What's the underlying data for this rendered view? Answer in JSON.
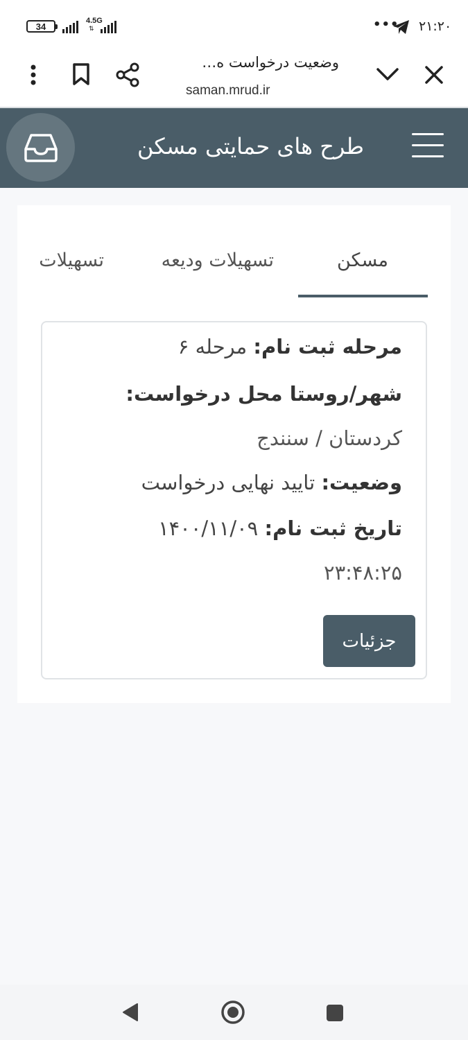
{
  "status_bar": {
    "battery": "34",
    "network_type": "4.5G",
    "time": "۲۱:۲۰",
    "more_dots": "•••"
  },
  "browser": {
    "page_title": "وضعیت درخواست ه…",
    "url": "saman.mrud.ir"
  },
  "header": {
    "title": "طرح های حمایتی مسکن"
  },
  "tabs": [
    {
      "label": "مسکن",
      "active": true
    },
    {
      "label": "تسهیلات ودیعه",
      "active": false
    },
    {
      "label": "تسهیلات",
      "active": false
    }
  ],
  "info": {
    "stage_label": "مرحله ثبت نام:",
    "stage_value": "مرحله ۶",
    "city_label": "شهر/روستا محل درخواست:",
    "city_value": "کردستان / سنندج",
    "status_label": "وضعیت:",
    "status_value": "تایید نهایی درخواست",
    "date_label": "تاریخ ثبت نام:",
    "date_value": "۱۴۰۰/۱۱/۰۹",
    "time_value": "۲۳:۴۸:۲۵",
    "details_button": "جزئیات"
  },
  "colors": {
    "header_bg": "#4a5d68",
    "button_bg": "#4a5d68",
    "page_bg": "#f7f8fa"
  },
  "icons": [
    "battery-icon",
    "signal-icon",
    "telegram-icon",
    "more-icon",
    "close-icon",
    "chevron-down-icon",
    "share-icon",
    "bookmark-icon",
    "kebab-menu-icon",
    "inbox-icon",
    "hamburger-icon",
    "back-icon",
    "home-icon",
    "recents-icon"
  ]
}
